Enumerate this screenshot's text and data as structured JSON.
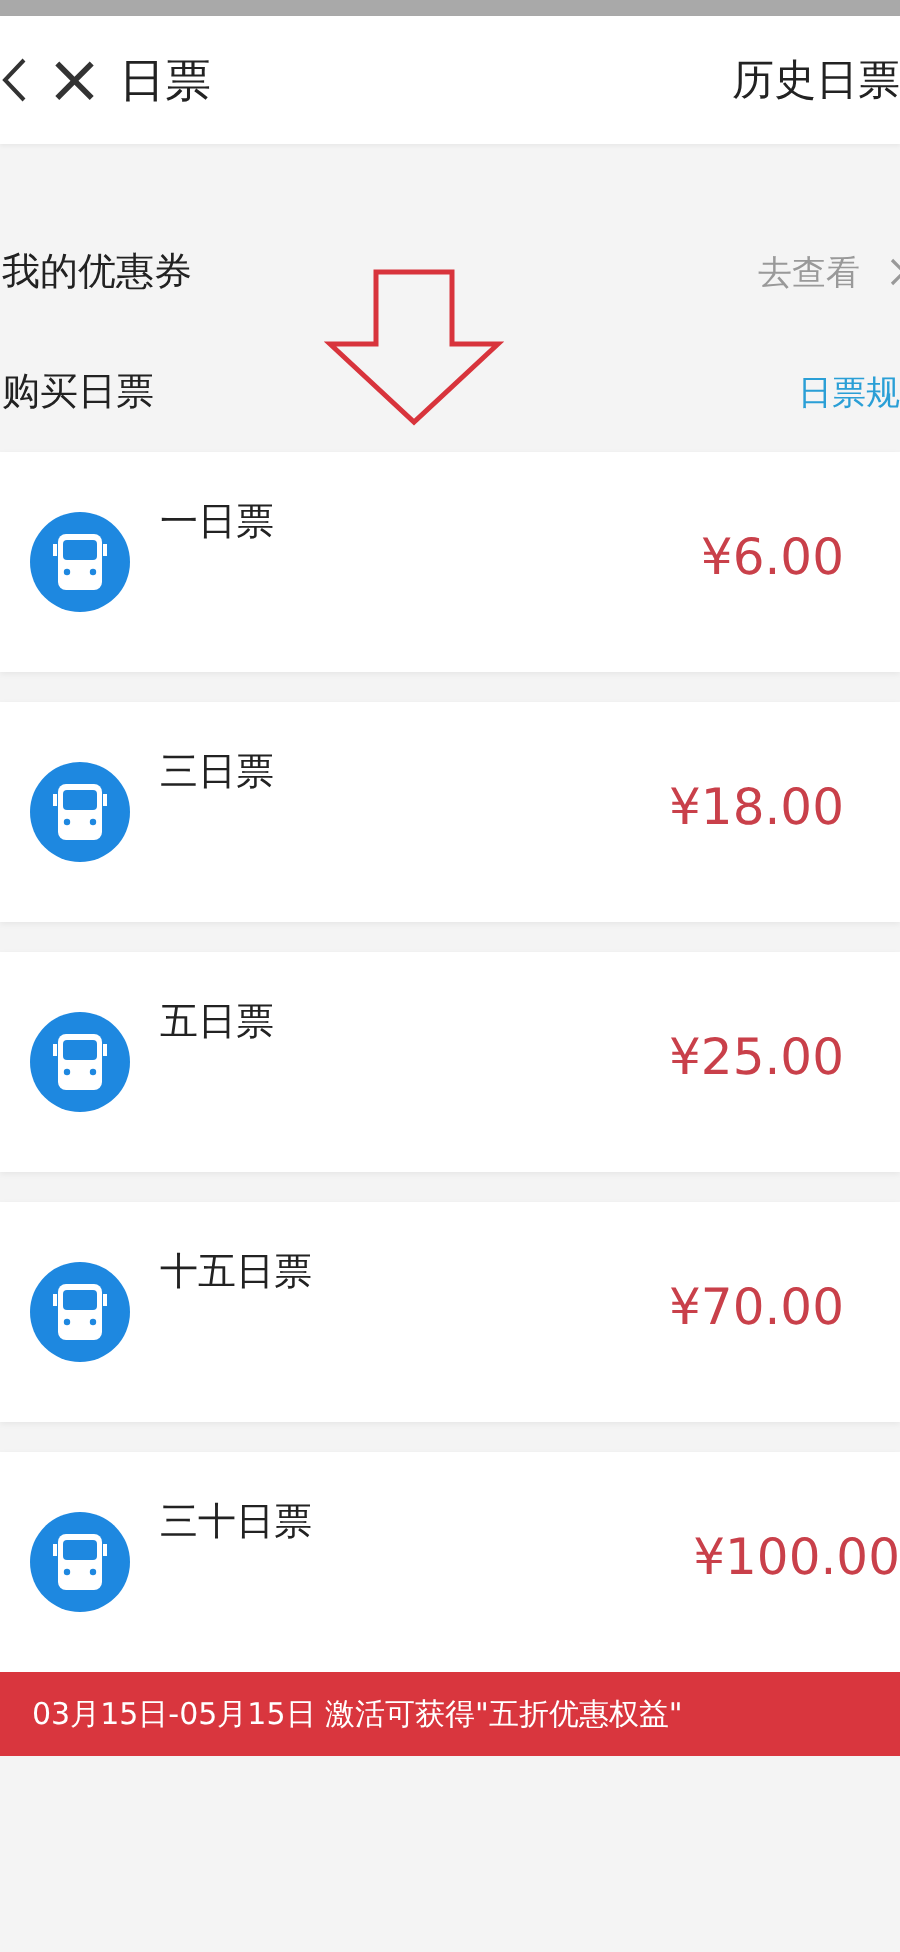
{
  "header": {
    "close": "×",
    "title": "日票",
    "history": "历史日票"
  },
  "coupon": {
    "label": "我的优惠券",
    "action": "去查看"
  },
  "purchase": {
    "label": "购买日票",
    "rules": "日票规"
  },
  "tickets": [
    {
      "name": "一日票",
      "price": "¥6.00"
    },
    {
      "name": "三日票",
      "price": "¥18.00"
    },
    {
      "name": "五日票",
      "price": "¥25.00"
    },
    {
      "name": "十五日票",
      "price": "¥70.00"
    },
    {
      "name": "三十日票",
      "price": "¥100.00"
    }
  ],
  "banner": "03月15日-05月15日 激活可获得\"五折优惠权益\""
}
